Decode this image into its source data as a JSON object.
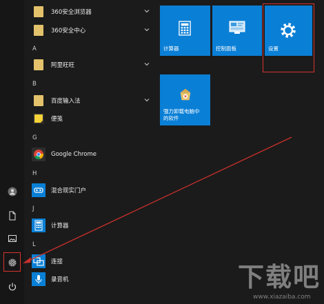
{
  "apps": {
    "section_letters": [
      "A",
      "B",
      "G",
      "H",
      "J",
      "L"
    ],
    "items": [
      {
        "label": "360安全浏览器"
      },
      {
        "label": "360安全中心"
      },
      {
        "label": "阿里旺旺"
      },
      {
        "label": "百度输入法"
      },
      {
        "label": "便笺"
      },
      {
        "label": "Google Chrome"
      },
      {
        "label": "混合现实门户"
      },
      {
        "label": "计算器"
      },
      {
        "label": "连接"
      },
      {
        "label": "录音机"
      }
    ]
  },
  "tiles": [
    {
      "label": "计算器"
    },
    {
      "label": "控制面板"
    },
    {
      "label": "设置"
    },
    {
      "label_line1": "强力卸载电脑中",
      "label_line2": "的软件"
    }
  ],
  "watermark": {
    "big": "下载吧",
    "small": "www.xiazaiba.com"
  },
  "colors": {
    "tile": "#0a7fd6",
    "highlight": "#d9332e",
    "background": "#1b1b1b"
  }
}
